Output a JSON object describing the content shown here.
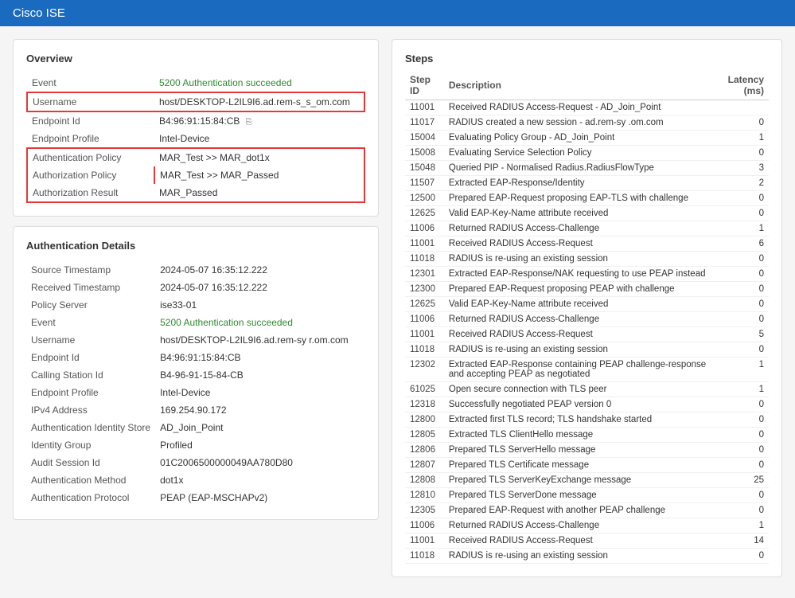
{
  "app": {
    "title": "Cisco",
    "title_suffix": " ISE"
  },
  "overview": {
    "heading": "Overview",
    "rows": [
      {
        "label": "Event",
        "value": "5200 Authentication succeeded",
        "green": true
      },
      {
        "label": "Username",
        "value": "host/DESKTOP-L2IL9I6.ad.rem-s_s_om.com",
        "highlight_red": true
      },
      {
        "label": "Endpoint Id",
        "value": "B4:96:91:15:84:CB",
        "copy": true
      },
      {
        "label": "Endpoint Profile",
        "value": "Intel-Device"
      }
    ],
    "policy_rows": [
      {
        "label": "Authentication Policy",
        "value": "MAR_Test >> MAR_dot1x"
      },
      {
        "label": "Authorization Policy",
        "value": "MAR_Test >> MAR_Passed"
      },
      {
        "label": "Authorization Result",
        "value": "MAR_Passed"
      }
    ]
  },
  "auth_details": {
    "heading": "Authentication Details",
    "rows": [
      {
        "label": "Source Timestamp",
        "value": "2024-05-07 16:35:12.222"
      },
      {
        "label": "Received Timestamp",
        "value": "2024-05-07 16:35:12.222"
      },
      {
        "label": "Policy Server",
        "value": "ise33-01"
      },
      {
        "label": "Event",
        "value": "5200 Authentication succeeded",
        "green": true
      },
      {
        "label": "Username",
        "value": "host/DESKTOP-L2IL9I6.ad.rem-sy r.om.com"
      },
      {
        "label": "Endpoint Id",
        "value": "B4:96:91:15:84:CB"
      },
      {
        "label": "Calling Station Id",
        "value": "B4-96-91-15-84-CB"
      },
      {
        "label": "Endpoint Profile",
        "value": "Intel-Device"
      },
      {
        "label": "IPv4 Address",
        "value": "169.254.90.172"
      },
      {
        "label": "Authentication Identity Store",
        "value": "AD_Join_Point"
      },
      {
        "label": "Identity Group",
        "value": "Profiled"
      },
      {
        "label": "Audit Session Id",
        "value": "01C2006500000049AA780D80"
      },
      {
        "label": "Authentication Method",
        "value": "dot1x"
      },
      {
        "label": "Authentication Protocol",
        "value": "PEAP (EAP-MSCHAPv2)"
      }
    ]
  },
  "steps": {
    "heading": "Steps",
    "columns": [
      "Step ID",
      "Description",
      "Latency (ms)"
    ],
    "rows": [
      {
        "id": "11001",
        "desc": "Received RADIUS Access-Request - AD_Join_Point",
        "latency": ""
      },
      {
        "id": "11017",
        "desc": "RADIUS created a new session - ad.rem-sy .om.com",
        "latency": "0"
      },
      {
        "id": "15004",
        "desc": "Evaluating Policy Group - AD_Join_Point",
        "latency": "1"
      },
      {
        "id": "15008",
        "desc": "Evaluating Service Selection Policy",
        "latency": "0"
      },
      {
        "id": "15048",
        "desc": "Queried PIP - Normalised Radius.RadiusFlowType",
        "latency": "3"
      },
      {
        "id": "11507",
        "desc": "Extracted EAP-Response/Identity",
        "latency": "2"
      },
      {
        "id": "12500",
        "desc": "Prepared EAP-Request proposing EAP-TLS with challenge",
        "latency": "0"
      },
      {
        "id": "12625",
        "desc": "Valid EAP-Key-Name attribute received",
        "latency": "0"
      },
      {
        "id": "11006",
        "desc": "Returned RADIUS Access-Challenge",
        "latency": "1"
      },
      {
        "id": "11001",
        "desc": "Received RADIUS Access-Request",
        "latency": "6"
      },
      {
        "id": "11018",
        "desc": "RADIUS is re-using an existing session",
        "latency": "0"
      },
      {
        "id": "12301",
        "desc": "Extracted EAP-Response/NAK requesting to use PEAP instead",
        "latency": "0"
      },
      {
        "id": "12300",
        "desc": "Prepared EAP-Request proposing PEAP with challenge",
        "latency": "0"
      },
      {
        "id": "12625",
        "desc": "Valid EAP-Key-Name attribute received",
        "latency": "0"
      },
      {
        "id": "11006",
        "desc": "Returned RADIUS Access-Challenge",
        "latency": "0"
      },
      {
        "id": "11001",
        "desc": "Received RADIUS Access-Request",
        "latency": "5"
      },
      {
        "id": "11018",
        "desc": "RADIUS is re-using an existing session",
        "latency": "0"
      },
      {
        "id": "12302",
        "desc": "Extracted EAP-Response containing PEAP challenge-response and accepting PEAP as negotiated",
        "latency": "1"
      },
      {
        "id": "61025",
        "desc": "Open secure connection with TLS peer",
        "latency": "1"
      },
      {
        "id": "12318",
        "desc": "Successfully negotiated PEAP version 0",
        "latency": "0"
      },
      {
        "id": "12800",
        "desc": "Extracted first TLS record; TLS handshake started",
        "latency": "0"
      },
      {
        "id": "12805",
        "desc": "Extracted TLS ClientHello message",
        "latency": "0"
      },
      {
        "id": "12806",
        "desc": "Prepared TLS ServerHello message",
        "latency": "0"
      },
      {
        "id": "12807",
        "desc": "Prepared TLS Certificate message",
        "latency": "0"
      },
      {
        "id": "12808",
        "desc": "Prepared TLS ServerKeyExchange message",
        "latency": "25"
      },
      {
        "id": "12810",
        "desc": "Prepared TLS ServerDone message",
        "latency": "0"
      },
      {
        "id": "12305",
        "desc": "Prepared EAP-Request with another PEAP challenge",
        "latency": "0"
      },
      {
        "id": "11006",
        "desc": "Returned RADIUS Access-Challenge",
        "latency": "1"
      },
      {
        "id": "11001",
        "desc": "Received RADIUS Access-Request",
        "latency": "14"
      },
      {
        "id": "11018",
        "desc": "RADIUS is re-using an existing session",
        "latency": "0"
      }
    ]
  }
}
